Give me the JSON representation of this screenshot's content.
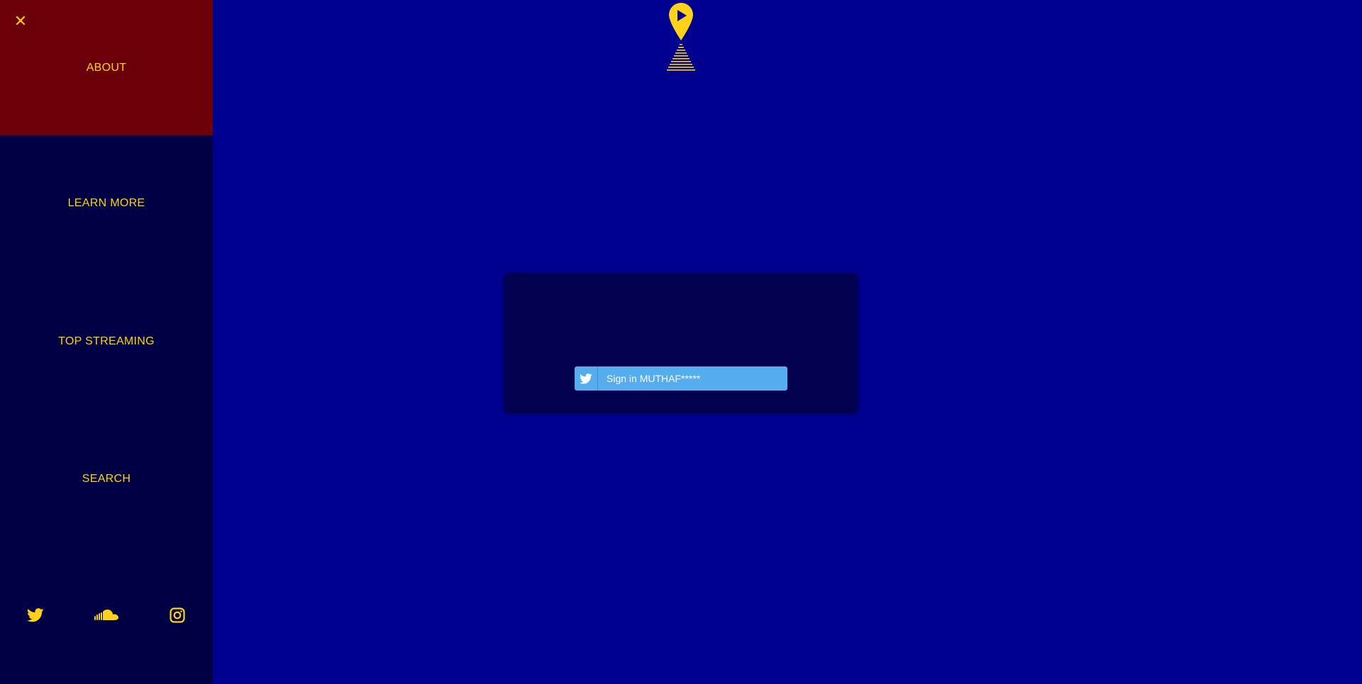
{
  "sidebar": {
    "close_icon": "close-icon",
    "items": [
      {
        "label": "ABOUT"
      },
      {
        "label": "LEARN MORE"
      },
      {
        "label": "TOP STREAMING"
      },
      {
        "label": "SEARCH"
      }
    ],
    "social": [
      "twitter-icon",
      "soundcloud-icon",
      "instagram-icon"
    ]
  },
  "logo": {
    "icon": "play-pin-logo-icon"
  },
  "signin": {
    "label": "Sign in MUTHAF*****",
    "icon": "twitter-icon"
  },
  "colors": {
    "background": "#00008f",
    "sidebar": "#000044",
    "active_item": "#6b0009",
    "accent": "#ffd21a",
    "card": "#00004f",
    "twitter_button": "#55acee"
  }
}
